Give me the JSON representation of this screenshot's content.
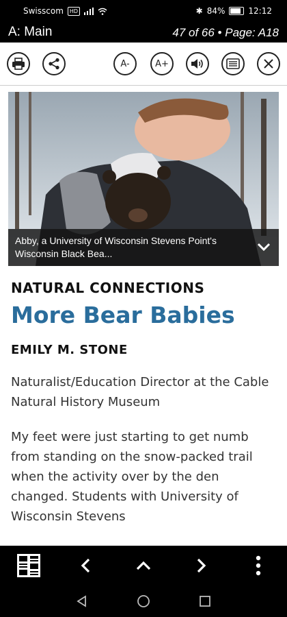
{
  "status": {
    "carrier": "Swisscom",
    "network": "HD",
    "battery": "84%",
    "time": "12:12"
  },
  "header": {
    "section": "A: Main",
    "page_info": "47 of 66 • Page: A18"
  },
  "toolbar": {
    "print": "print-icon",
    "share": "share-icon",
    "font_smaller": "A-",
    "font_larger": "A+",
    "audio": "speaker-icon",
    "text_view": "text-view-icon",
    "close": "close-icon"
  },
  "photo": {
    "caption": "Abby, a University of Wisconsin Stevens Point's Wisconsin Black Bea..."
  },
  "article": {
    "kicker": "NATURAL CONNECTIONS",
    "headline": "More Bear Babies",
    "author": "EMILY M. STONE",
    "author_role": "Naturalist/Education Director at the Cable Natural History Museum",
    "body": "My feet were just starting to get numb from standing on the snow-packed trail when the activity over by the den changed. Students with University of Wisconsin Stevens"
  },
  "colors": {
    "headline": "#2a6d9c",
    "bars": "#000000"
  }
}
